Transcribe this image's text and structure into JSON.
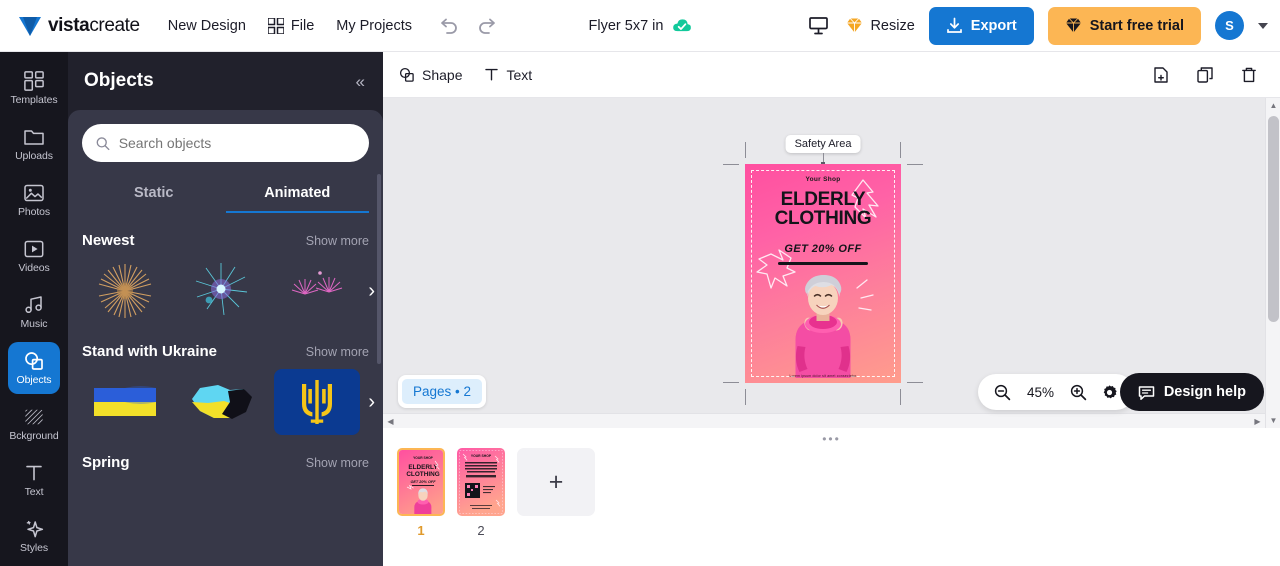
{
  "topbar": {
    "brand_bold": "vista",
    "brand_thin": "create",
    "nav": [
      {
        "label": "New Design",
        "icon": "none"
      },
      {
        "label": "File",
        "icon": "grid-icon"
      },
      {
        "label": "My Projects",
        "icon": "none"
      }
    ],
    "undo_label": "Undo",
    "redo_label": "Redo",
    "doc_title": "Flyer 5x7 in",
    "cloud_status": "saved",
    "present_label": "Present",
    "resize_label": "Resize",
    "export_label": "Export",
    "trial_label": "Start free trial",
    "avatar_initial": "S"
  },
  "rail": {
    "items": [
      {
        "label": "Templates",
        "icon": "templates-icon",
        "active": false
      },
      {
        "label": "Uploads",
        "icon": "folder-icon",
        "active": false
      },
      {
        "label": "Photos",
        "icon": "photo-icon",
        "active": false
      },
      {
        "label": "Videos",
        "icon": "video-icon",
        "active": false
      },
      {
        "label": "Music",
        "icon": "music-icon",
        "active": false
      },
      {
        "label": "Objects",
        "icon": "objects-icon",
        "active": true
      },
      {
        "label": "Bckground",
        "icon": "background-icon",
        "active": false
      },
      {
        "label": "Text",
        "icon": "text-icon",
        "active": false
      },
      {
        "label": "Styles",
        "icon": "styles-icon",
        "active": false
      }
    ]
  },
  "panel": {
    "title": "Objects",
    "collapse_label": "«",
    "search_placeholder": "Search objects",
    "search_value": "",
    "tabs": [
      {
        "label": "Static",
        "active": false
      },
      {
        "label": "Animated",
        "active": true
      }
    ],
    "sections": [
      {
        "title": "Newest",
        "more_label": "Show more",
        "tiles": [
          "firework-gold",
          "firework-blue",
          "firework-pink"
        ]
      },
      {
        "title": "Stand with Ukraine",
        "more_label": "Show more",
        "tiles": [
          "ukraine-flag",
          "ukraine-map",
          "ukraine-trident"
        ]
      },
      {
        "title": "Spring",
        "more_label": "Show more",
        "tiles": []
      }
    ]
  },
  "canvas_toolbar": {
    "shape_label": "Shape",
    "text_label": "Text",
    "add_page_label": "Add page",
    "duplicate_label": "Duplicate",
    "delete_label": "Delete"
  },
  "canvas": {
    "safety_area_label": "Safety Area",
    "flyer": {
      "shop_label": "Your Shop",
      "headline_line1": "ELDERLY",
      "headline_line2": "CLOTHING",
      "subhead": "GET 20% OFF",
      "footer": "Lorem ipsum dolor sit amet consectetur",
      "bg_color_start": "#ff4fa0",
      "bg_color_end": "#ff9d8c"
    }
  },
  "bottom": {
    "pages_chip_label": "Pages • 2",
    "zoom_value": "45%",
    "zoom_out_label": "Zoom out",
    "zoom_in_label": "Zoom in",
    "settings_label": "Settings",
    "design_help_label": "Design help",
    "thumbs": [
      {
        "number": "1",
        "selected": true
      },
      {
        "number": "2",
        "selected": false
      }
    ],
    "add_page_symbol": "+"
  },
  "colors": {
    "accent_blue": "#1577d2",
    "accent_orange": "#fcb654",
    "rail_bg": "#16161e",
    "panel_bg": "#373848",
    "stage_bg": "#e9e9ec"
  }
}
